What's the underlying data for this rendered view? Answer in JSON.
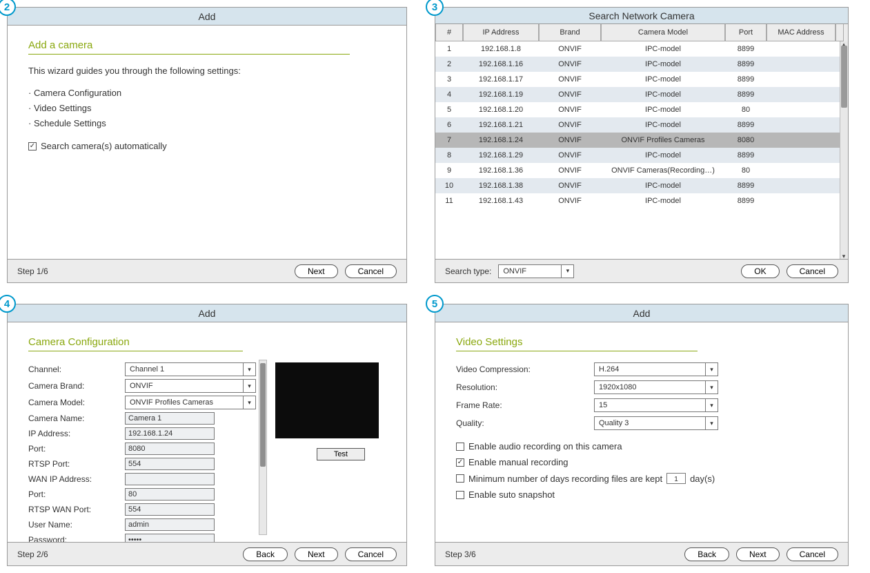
{
  "markers": {
    "p2": "2",
    "p3": "3",
    "p4": "4",
    "p5": "5"
  },
  "panel2": {
    "title": "Add",
    "section": "Add a camera",
    "intro": "This wizard guides you through the following settings:",
    "b1": "· Camera Configuration",
    "b2": "· Video Settings",
    "b3": "· Schedule Settings",
    "auto_label": "Search camera(s) automatically",
    "step": "Step 1/6",
    "next": "Next",
    "cancel": "Cancel"
  },
  "panel3": {
    "title": "Search Network Camera",
    "h_num": "#",
    "h_ip": "IP Address",
    "h_brand": "Brand",
    "h_model": "Camera Model",
    "h_port": "Port",
    "h_mac": "MAC Address",
    "rows": [
      {
        "n": "1",
        "ip": "192.168.1.8",
        "brand": "ONVIF",
        "model": "IPC-model",
        "port": "8899",
        "mac": ""
      },
      {
        "n": "2",
        "ip": "192.168.1.16",
        "brand": "ONVIF",
        "model": "IPC-model",
        "port": "8899",
        "mac": ""
      },
      {
        "n": "3",
        "ip": "192.168.1.17",
        "brand": "ONVIF",
        "model": "IPC-model",
        "port": "8899",
        "mac": ""
      },
      {
        "n": "4",
        "ip": "192.168.1.19",
        "brand": "ONVIF",
        "model": "IPC-model",
        "port": "8899",
        "mac": ""
      },
      {
        "n": "5",
        "ip": "192.168.1.20",
        "brand": "ONVIF",
        "model": "IPC-model",
        "port": "80",
        "mac": ""
      },
      {
        "n": "6",
        "ip": "192.168.1.21",
        "brand": "ONVIF",
        "model": "IPC-model",
        "port": "8899",
        "mac": ""
      },
      {
        "n": "7",
        "ip": "192.168.1.24",
        "brand": "ONVIF",
        "model": "ONVIF Profiles Cameras",
        "port": "8080",
        "mac": ""
      },
      {
        "n": "8",
        "ip": "192.168.1.29",
        "brand": "ONVIF",
        "model": "IPC-model",
        "port": "8899",
        "mac": ""
      },
      {
        "n": "9",
        "ip": "192.168.1.36",
        "brand": "ONVIF",
        "model": "ONVIF Cameras(Recording…)",
        "port": "80",
        "mac": ""
      },
      {
        "n": "10",
        "ip": "192.168.1.38",
        "brand": "ONVIF",
        "model": "IPC-model",
        "port": "8899",
        "mac": ""
      },
      {
        "n": "11",
        "ip": "192.168.1.43",
        "brand": "ONVIF",
        "model": "IPC-model",
        "port": "8899",
        "mac": ""
      }
    ],
    "search_type_label": "Search type:",
    "search_type_value": "ONVIF",
    "ok": "OK",
    "cancel": "Cancel"
  },
  "panel4": {
    "title": "Add",
    "section": "Camera Configuration",
    "l_channel": "Channel:",
    "v_channel": "Channel 1",
    "l_brand": "Camera Brand:",
    "v_brand": "ONVIF",
    "l_model": "Camera Model:",
    "v_model": "ONVIF Profiles Cameras",
    "l_name": "Camera Name:",
    "v_name": "Camera 1",
    "l_ip": "IP Address:",
    "v_ip": "192.168.1.24",
    "l_port": "Port:",
    "v_port": "8080",
    "l_rtsp": "RTSP Port:",
    "v_rtsp": "554",
    "l_wanip": "WAN IP Address:",
    "v_wanip": "",
    "l_port2": "Port:",
    "v_port2": "80",
    "l_rtspwan": "RTSP WAN Port:",
    "v_rtspwan": "554",
    "l_user": "User Name:",
    "v_user": "admin",
    "l_pass": "Password:",
    "v_pass": "•••••",
    "test": "Test",
    "step": "Step 2/6",
    "back": "Back",
    "next": "Next",
    "cancel": "Cancel"
  },
  "panel5": {
    "title": "Add",
    "section": "Video Settings",
    "l_comp": "Video Compression:",
    "v_comp": "H.264",
    "l_res": "Resolution:",
    "v_res": "1920x1080",
    "l_fr": "Frame Rate:",
    "v_fr": "15",
    "l_q": "Quality:",
    "v_q": "Quality 3",
    "c1": "Enable audio recording on this camera",
    "c2": "Enable manual recording",
    "c3a": "Minimum number of days recording files are kept",
    "c3_val": "1",
    "c3b": "day(s)",
    "c4": "Enable suto snapshot",
    "step": "Step 3/6",
    "back": "Back",
    "next": "Next",
    "cancel": "Cancel"
  }
}
